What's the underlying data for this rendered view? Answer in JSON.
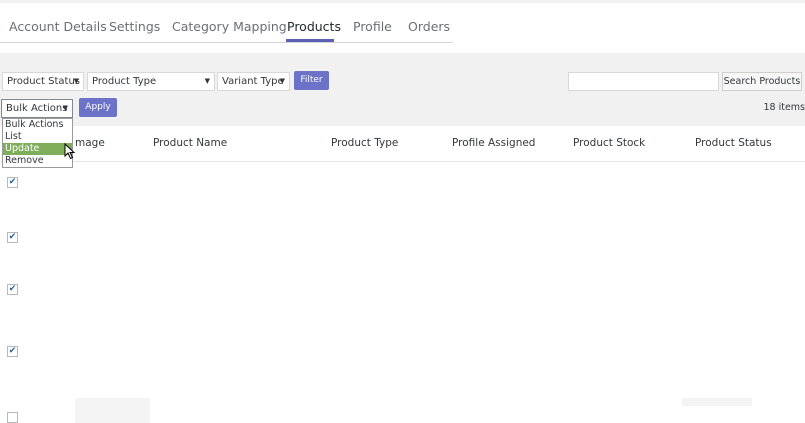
{
  "tabs": [
    "Account Details",
    "Settings",
    "Category Mapping",
    "Products",
    "Profile",
    "Orders"
  ],
  "filters": {
    "product_status": "Product Status",
    "product_type": "Product Type",
    "variant_type": "Variant Type",
    "filter_label": "Filter",
    "search_button": "Search Products"
  },
  "bulk": {
    "selected": "Bulk Actions",
    "apply_label": "Apply",
    "options": [
      "Bulk Actions",
      "List",
      "Update",
      "Remove"
    ],
    "highlighted": "Update"
  },
  "items_count": "18 items",
  "table": {
    "columns": [
      "mage",
      "Product Name",
      "Product Type",
      "Profile Assigned",
      "Product Stock",
      "Product Status"
    ],
    "rows_checked": [
      true,
      true,
      true,
      true,
      false
    ]
  },
  "colors": {
    "accent": "#5b5fb8",
    "button": "#6b72c8",
    "highlight": "#7fae5a"
  }
}
